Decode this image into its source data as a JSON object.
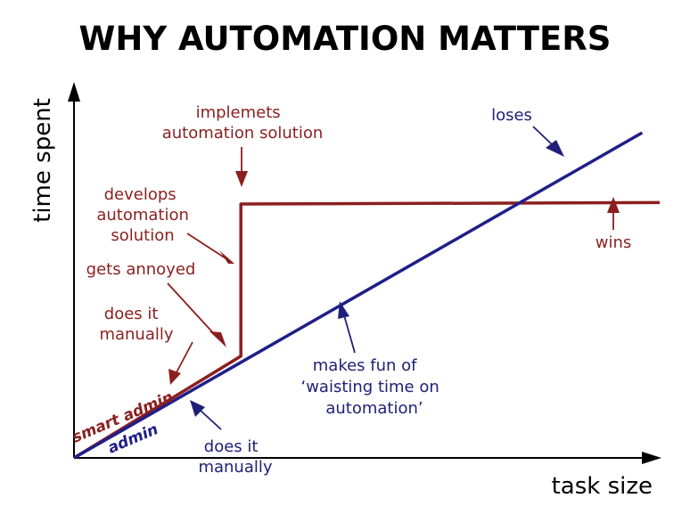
{
  "chart_data": {
    "type": "line",
    "title": "WHY AUTOMATION MATTERS",
    "xlabel": "task size",
    "ylabel": "time spent",
    "xlim": [
      0,
      100
    ],
    "ylim": [
      0,
      100
    ],
    "grid": false,
    "legend": "none",
    "series": [
      {
        "name": "smart admin",
        "color": "#8b1f1f",
        "x": [
          0,
          28.5,
          28.5,
          100
        ],
        "y": [
          0,
          28.4,
          70.9,
          71.3
        ]
      },
      {
        "name": "admin",
        "color": "#1f1f88",
        "x": [
          0,
          97
        ],
        "y": [
          0,
          90.8
        ]
      }
    ],
    "annotations": [
      {
        "id": "implements",
        "lines": [
          "implemets",
          "automation solution"
        ],
        "color": "#8b1f1f"
      },
      {
        "id": "develops",
        "lines": [
          "develops",
          "automation",
          "solution"
        ],
        "color": "#8b1f1f"
      },
      {
        "id": "annoyed",
        "lines": [
          "gets annoyed"
        ],
        "color": "#8b1f1f"
      },
      {
        "id": "manual_smart",
        "lines": [
          "does it",
          "manually"
        ],
        "color": "#8b1f1f"
      },
      {
        "id": "wins",
        "lines": [
          "wins"
        ],
        "color": "#8b1f1f"
      },
      {
        "id": "loses",
        "lines": [
          "loses"
        ],
        "color": "#20207a"
      },
      {
        "id": "makes_fun",
        "lines": [
          "makes fun of",
          "‘waisting time on",
          "automation’"
        ],
        "color": "#20207a"
      },
      {
        "id": "manual_admin",
        "lines": [
          "does it",
          "manually"
        ],
        "color": "#20207a"
      }
    ]
  }
}
